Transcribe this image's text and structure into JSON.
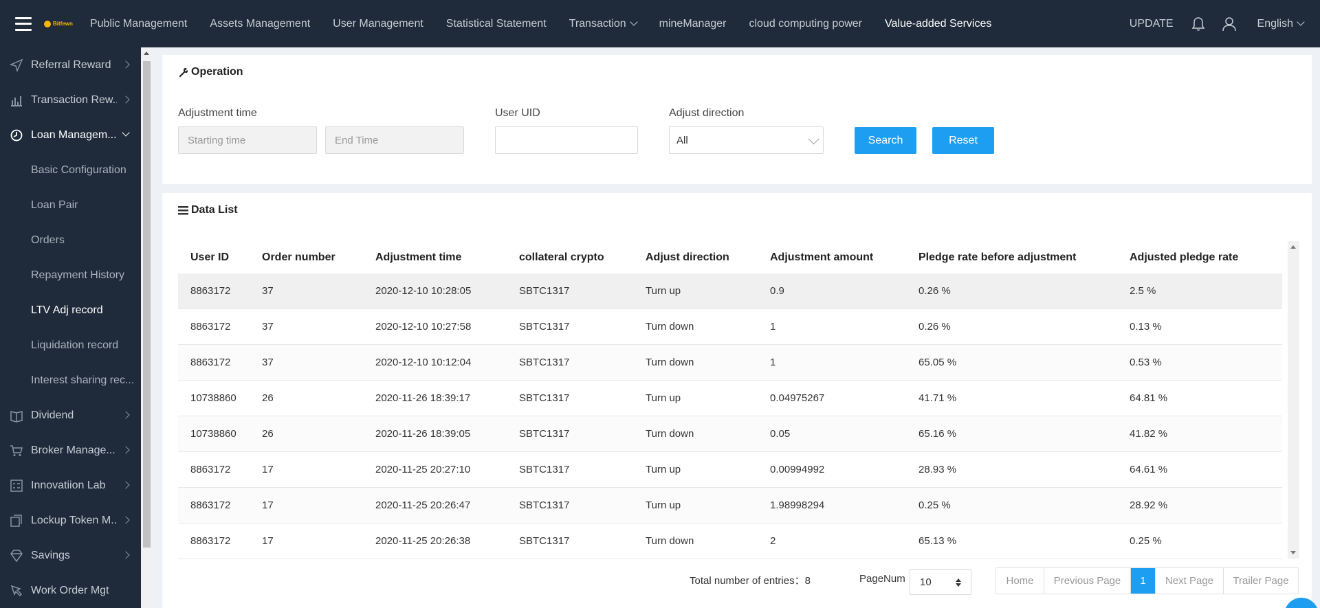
{
  "topbar": {
    "logo_text": "Bitfewn",
    "nav": [
      {
        "label": "Public Management"
      },
      {
        "label": "Assets Management"
      },
      {
        "label": "User Management"
      },
      {
        "label": "Statistical Statement"
      },
      {
        "label": "Transaction"
      },
      {
        "label": "mineManager"
      },
      {
        "label": "cloud computing power"
      },
      {
        "label": "Value-added Services"
      }
    ],
    "update": "UPDATE",
    "language": "English"
  },
  "sidebar": {
    "items": [
      {
        "label": "Referral Reward",
        "icon": "send-icon"
      },
      {
        "label": "Transaction Rew...",
        "icon": "bar-chart-icon"
      },
      {
        "label": "Loan Managem...",
        "icon": "loan-icon"
      },
      {
        "label": "Dividend",
        "icon": "book-icon"
      },
      {
        "label": "Broker Manage...",
        "icon": "cart-icon"
      },
      {
        "label": "Innovatiion Lab",
        "icon": "lab-icon"
      },
      {
        "label": "Lockup Token M...",
        "icon": "lock-doc-icon"
      },
      {
        "label": "Savings",
        "icon": "diamond-icon"
      },
      {
        "label": "Work Order Mgt",
        "icon": "work-order-icon"
      }
    ],
    "sub": [
      {
        "label": "Basic Configuration"
      },
      {
        "label": "Loan Pair"
      },
      {
        "label": "Orders"
      },
      {
        "label": "Repayment History"
      },
      {
        "label": "LTV Adj record"
      },
      {
        "label": "Liquidation record"
      },
      {
        "label": "Interest sharing rec..."
      }
    ]
  },
  "operation": {
    "title": "Operation",
    "adjustment_time_label": "Adjustment time",
    "start_placeholder": "Starting time",
    "end_placeholder": "End Time",
    "uid_label": "User UID",
    "uid_value": "",
    "direction_label": "Adjust direction",
    "direction_value": "All",
    "search": "Search",
    "reset": "Reset"
  },
  "list": {
    "title": "Data List",
    "columns": [
      "User ID",
      "Order number",
      "Adjustment time",
      "collateral crypto",
      "Adjust direction",
      "Adjustment amount",
      "Pledge rate before adjustment",
      "Adjusted pledge rate"
    ],
    "rows": [
      [
        "8863172",
        "37",
        "2020-12-10 10:28:05",
        "SBTC1317",
        "Turn up",
        "0.9",
        "0.26 %",
        "2.5 %"
      ],
      [
        "8863172",
        "37",
        "2020-12-10 10:27:58",
        "SBTC1317",
        "Turn down",
        "1",
        "0.26 %",
        "0.13 %"
      ],
      [
        "8863172",
        "37",
        "2020-12-10 10:12:04",
        "SBTC1317",
        "Turn down",
        "1",
        "65.05 %",
        "0.53 %"
      ],
      [
        "10738860",
        "26",
        "2020-11-26 18:39:17",
        "SBTC1317",
        "Turn up",
        "0.04975267",
        "41.71 %",
        "64.81 %"
      ],
      [
        "10738860",
        "26",
        "2020-11-26 18:39:05",
        "SBTC1317",
        "Turn down",
        "0.05",
        "65.16 %",
        "41.82 %"
      ],
      [
        "8863172",
        "17",
        "2020-11-25 20:27:10",
        "SBTC1317",
        "Turn up",
        "0.00994992",
        "28.93 %",
        "64.61 %"
      ],
      [
        "8863172",
        "17",
        "2020-11-25 20:26:47",
        "SBTC1317",
        "Turn up",
        "1.98998294",
        "0.25 %",
        "28.92 %"
      ],
      [
        "8863172",
        "17",
        "2020-11-25 20:26:38",
        "SBTC1317",
        "Turn down",
        "2",
        "65.13 %",
        "0.25 %"
      ]
    ]
  },
  "pagination": {
    "total_label": "Total number of entries：",
    "total": "8",
    "pagenum_label": "PageNum",
    "page_size": "10",
    "home": "Home",
    "prev": "Previous Page",
    "current": "1",
    "next": "Next Page",
    "trailer": "Trailer Page"
  },
  "colors": {
    "navy": "#1f2a3a",
    "accent": "#1e9ef0"
  }
}
